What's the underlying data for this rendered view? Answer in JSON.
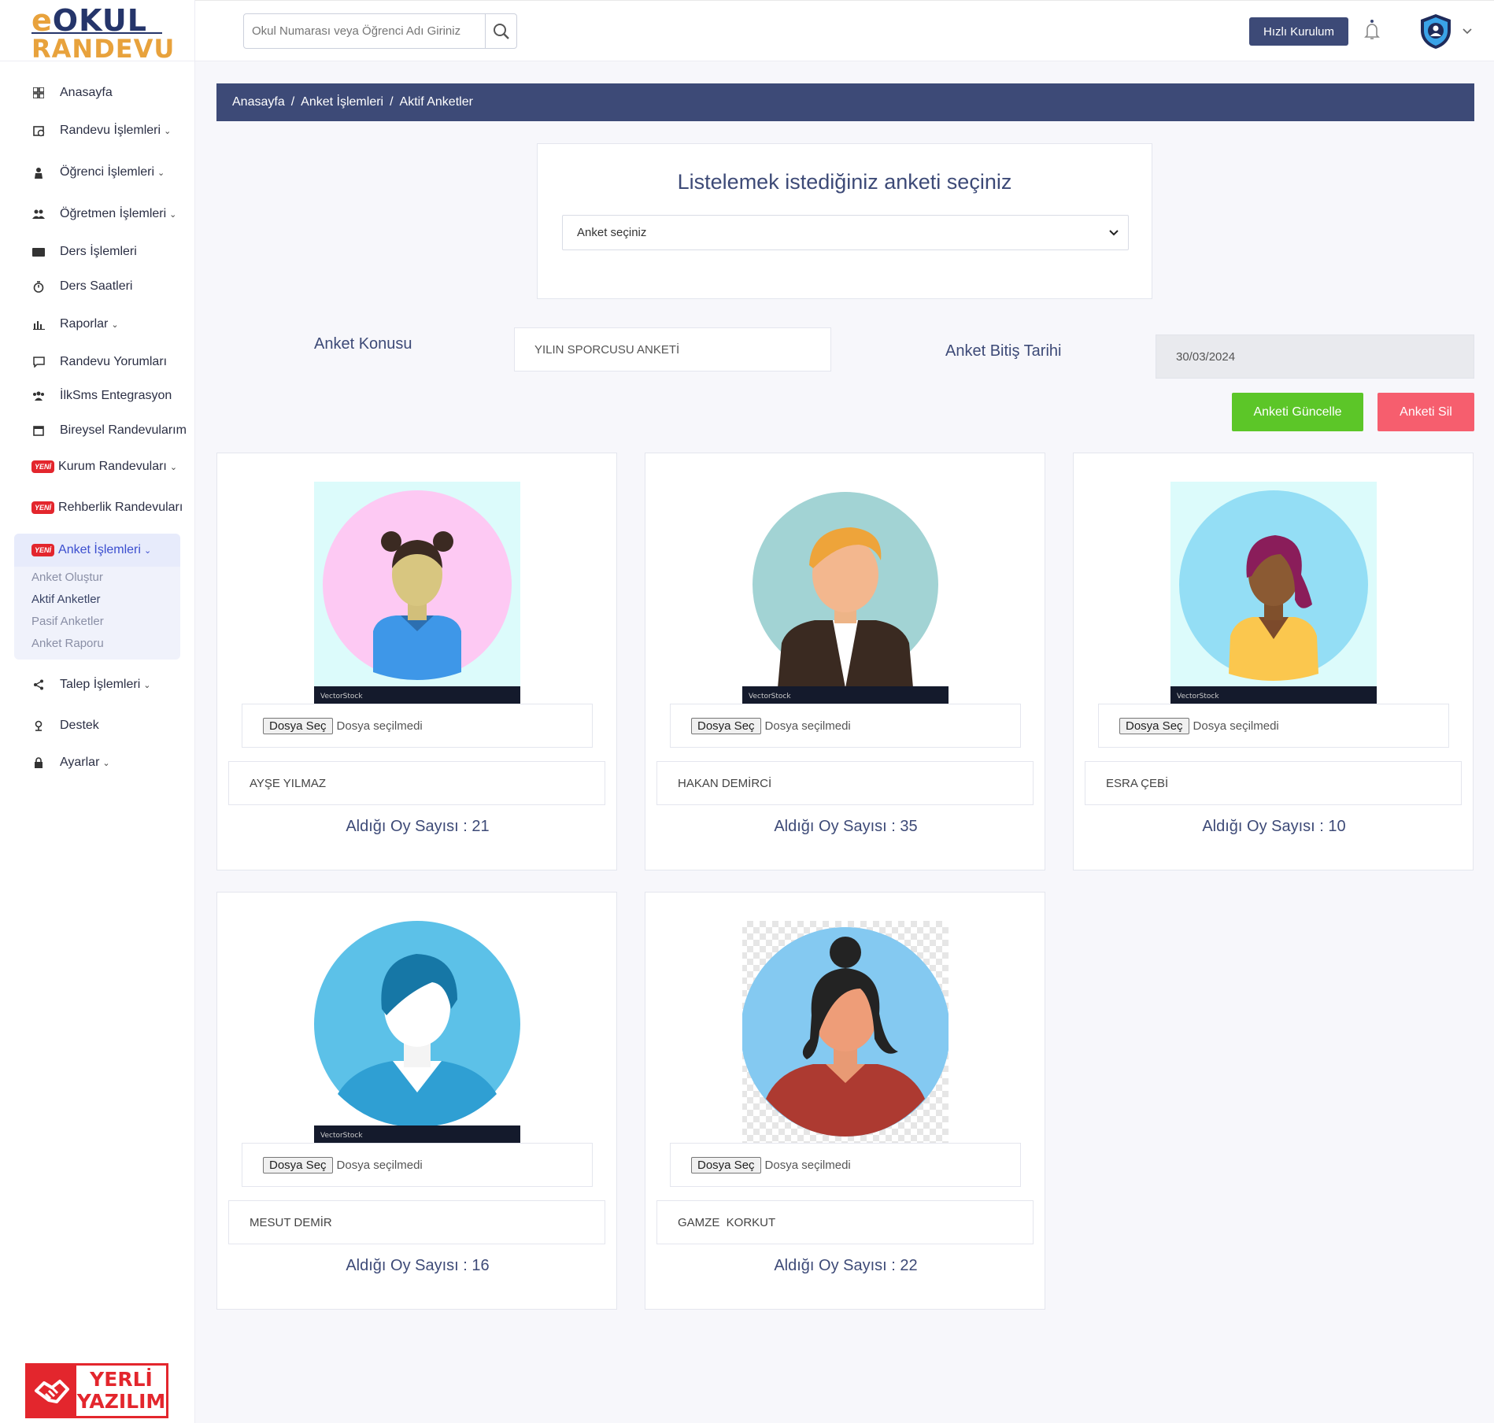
{
  "logo": {
    "top_prefix": "e",
    "top_rest": "OKUL",
    "bottom": "RANDEVU"
  },
  "search": {
    "placeholder": "Okul Numarası veya Öğrenci Adı Giriniz"
  },
  "header": {
    "quick_setup": "Hızlı Kurulum"
  },
  "sidebar": {
    "items": [
      {
        "label": "Anasayfa",
        "icon": "dashboard-icon",
        "caret": false
      },
      {
        "label": "Randevu İşlemleri",
        "icon": "calendar-clock-icon",
        "caret": true
      },
      {
        "label": "Öğrenci İşlemleri",
        "icon": "student-icon",
        "caret": true
      },
      {
        "label": "Öğretmen İşlemleri",
        "icon": "teachers-icon",
        "caret": true
      },
      {
        "label": "Ders İşlemleri",
        "icon": "book-icon",
        "caret": false
      },
      {
        "label": "Ders Saatleri",
        "icon": "stopwatch-icon",
        "caret": false
      },
      {
        "label": "Raporlar",
        "icon": "bar-chart-icon",
        "caret": true
      },
      {
        "label": "Randevu Yorumları",
        "icon": "comment-icon",
        "caret": false
      },
      {
        "label": "İlkSms Entegrasyon",
        "icon": "users-icon",
        "caret": false
      },
      {
        "label": "Bireysel Randevularım",
        "icon": "calendar-icon",
        "caret": false
      },
      {
        "label": "Kurum Randevuları",
        "badge": "YENİ",
        "caret": true
      },
      {
        "label": "Rehberlik Randevuları",
        "badge": "YENİ",
        "caret": false
      }
    ],
    "active_group": {
      "label": "Anket İşlemleri",
      "badge": "YENİ",
      "sub": [
        "Anket Oluştur",
        "Aktif Anketler",
        "Pasif Anketler",
        "Anket Raporu"
      ]
    },
    "bottom_items": [
      {
        "label": "Talep İşlemleri",
        "icon": "share-icon",
        "caret": true
      },
      {
        "label": "Destek",
        "icon": "support-icon",
        "caret": false
      },
      {
        "label": "Ayarlar",
        "icon": "lock-icon",
        "caret": true
      }
    ],
    "footer_logo": {
      "line1": "YERLİ",
      "line2": "YAZILIM"
    }
  },
  "breadcrumb": [
    "Anasayfa",
    "/",
    "Anket İşlemleri",
    "/",
    "Aktif Anketler"
  ],
  "survey_select": {
    "title": "Listelemek istediğiniz anketi seçiniz",
    "selected": "Anket seçiniz"
  },
  "survey": {
    "topic_label": "Anket Konusu",
    "topic_value": "YILIN SPORCUSU ANKETİ",
    "end_label": "Anket Bitiş Tarihi",
    "end_value": "30/03/2024",
    "update_button": "Anketi Güncelle",
    "delete_button": "Anketi Sil"
  },
  "file_input": {
    "button": "Dosya Seç",
    "status": "Dosya seçilmedi"
  },
  "votes_label": "Aldığı Oy Sayısı :",
  "candidates": [
    {
      "name": "AYŞE YILMAZ",
      "votes": "21",
      "avatar": "girl-avatar"
    },
    {
      "name": "HAKAN DEMİRCİ",
      "votes": "35",
      "avatar": "man-avatar"
    },
    {
      "name": "ESRA ÇEBİ",
      "votes": "10",
      "avatar": "woman-avatar"
    },
    {
      "name": "MESUT DEMİR",
      "votes": "16",
      "avatar": "man-blue-avatar"
    },
    {
      "name": "GAMZE  KORKUT",
      "votes": "22",
      "avatar": "woman-bun-avatar"
    }
  ],
  "colors": {
    "primary": "#3d4a77",
    "accent": "#e8a23c",
    "success": "#5cc628",
    "danger": "#f65e6e",
    "badge": "#e3262d"
  }
}
